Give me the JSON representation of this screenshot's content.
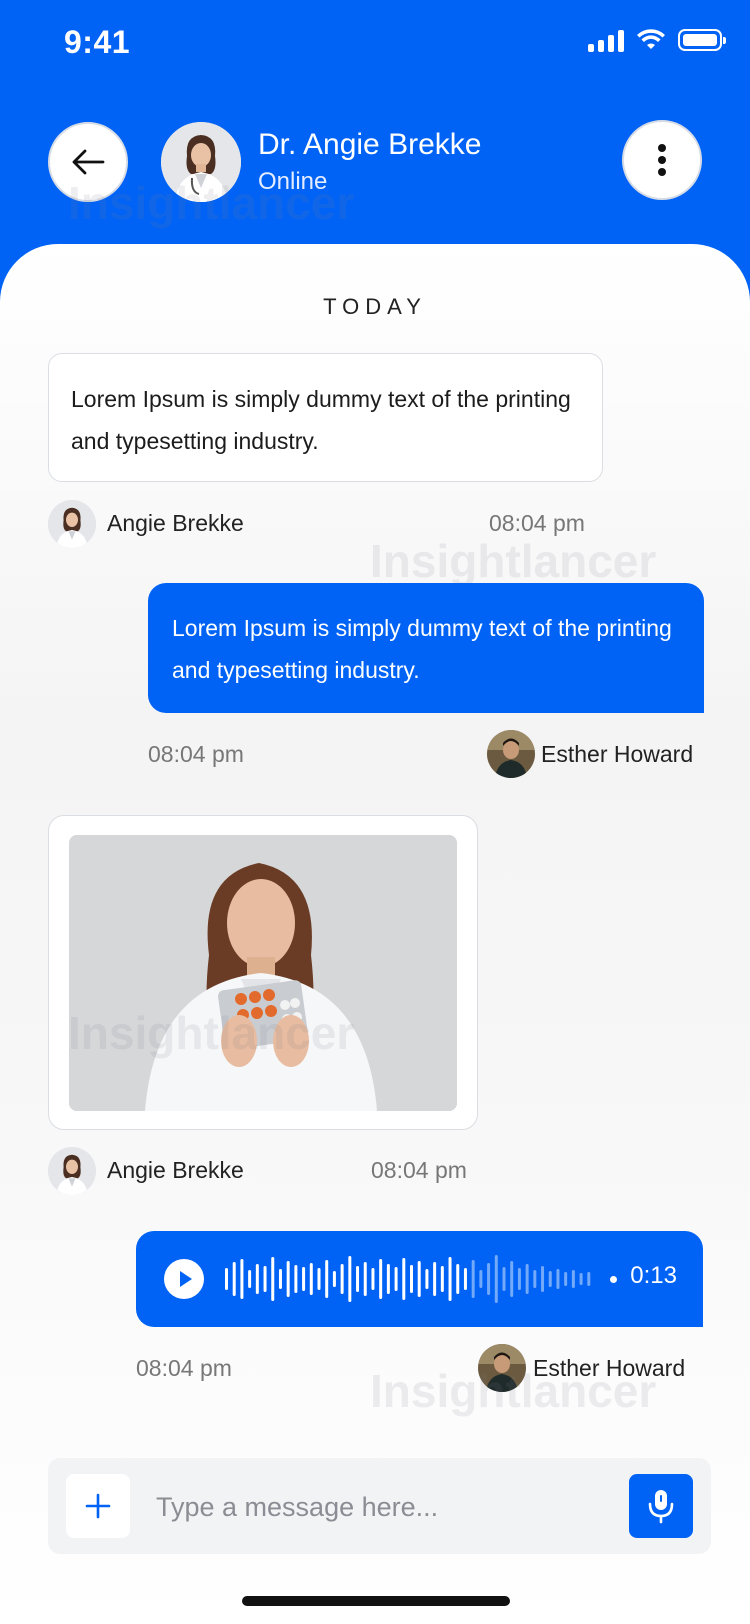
{
  "status_bar": {
    "time": "9:41"
  },
  "header": {
    "doctor_name": "Dr. Angie Brekke",
    "status": "Online"
  },
  "watermark": "Insightlancer",
  "day_label": "TODAY",
  "messages": [
    {
      "type": "text",
      "direction": "incoming",
      "text": "Lorem Ipsum is simply dummy text of the printing and typesetting industry.",
      "sender": "Angie Brekke",
      "time": "08:04 pm"
    },
    {
      "type": "text",
      "direction": "outgoing",
      "text": "Lorem Ipsum is simply dummy text of the printing and typesetting industry.",
      "sender": "Esther Howard",
      "time": "08:04 pm"
    },
    {
      "type": "image",
      "direction": "incoming",
      "sender": "Angie Brekke",
      "time": "08:04 pm"
    },
    {
      "type": "audio",
      "direction": "outgoing",
      "duration": "0:13",
      "played_fraction": 0.66,
      "sender": "Esther Howard",
      "time": "08:04 pm"
    }
  ],
  "composer": {
    "placeholder": "Type a message here..."
  },
  "icons": {
    "back": "arrow-left-icon",
    "more": "more-vertical-icon",
    "add": "plus-icon",
    "mic": "microphone-icon",
    "play": "play-icon"
  },
  "colors": {
    "brand": "#0063f5",
    "input_bg": "#f2f3f5"
  }
}
